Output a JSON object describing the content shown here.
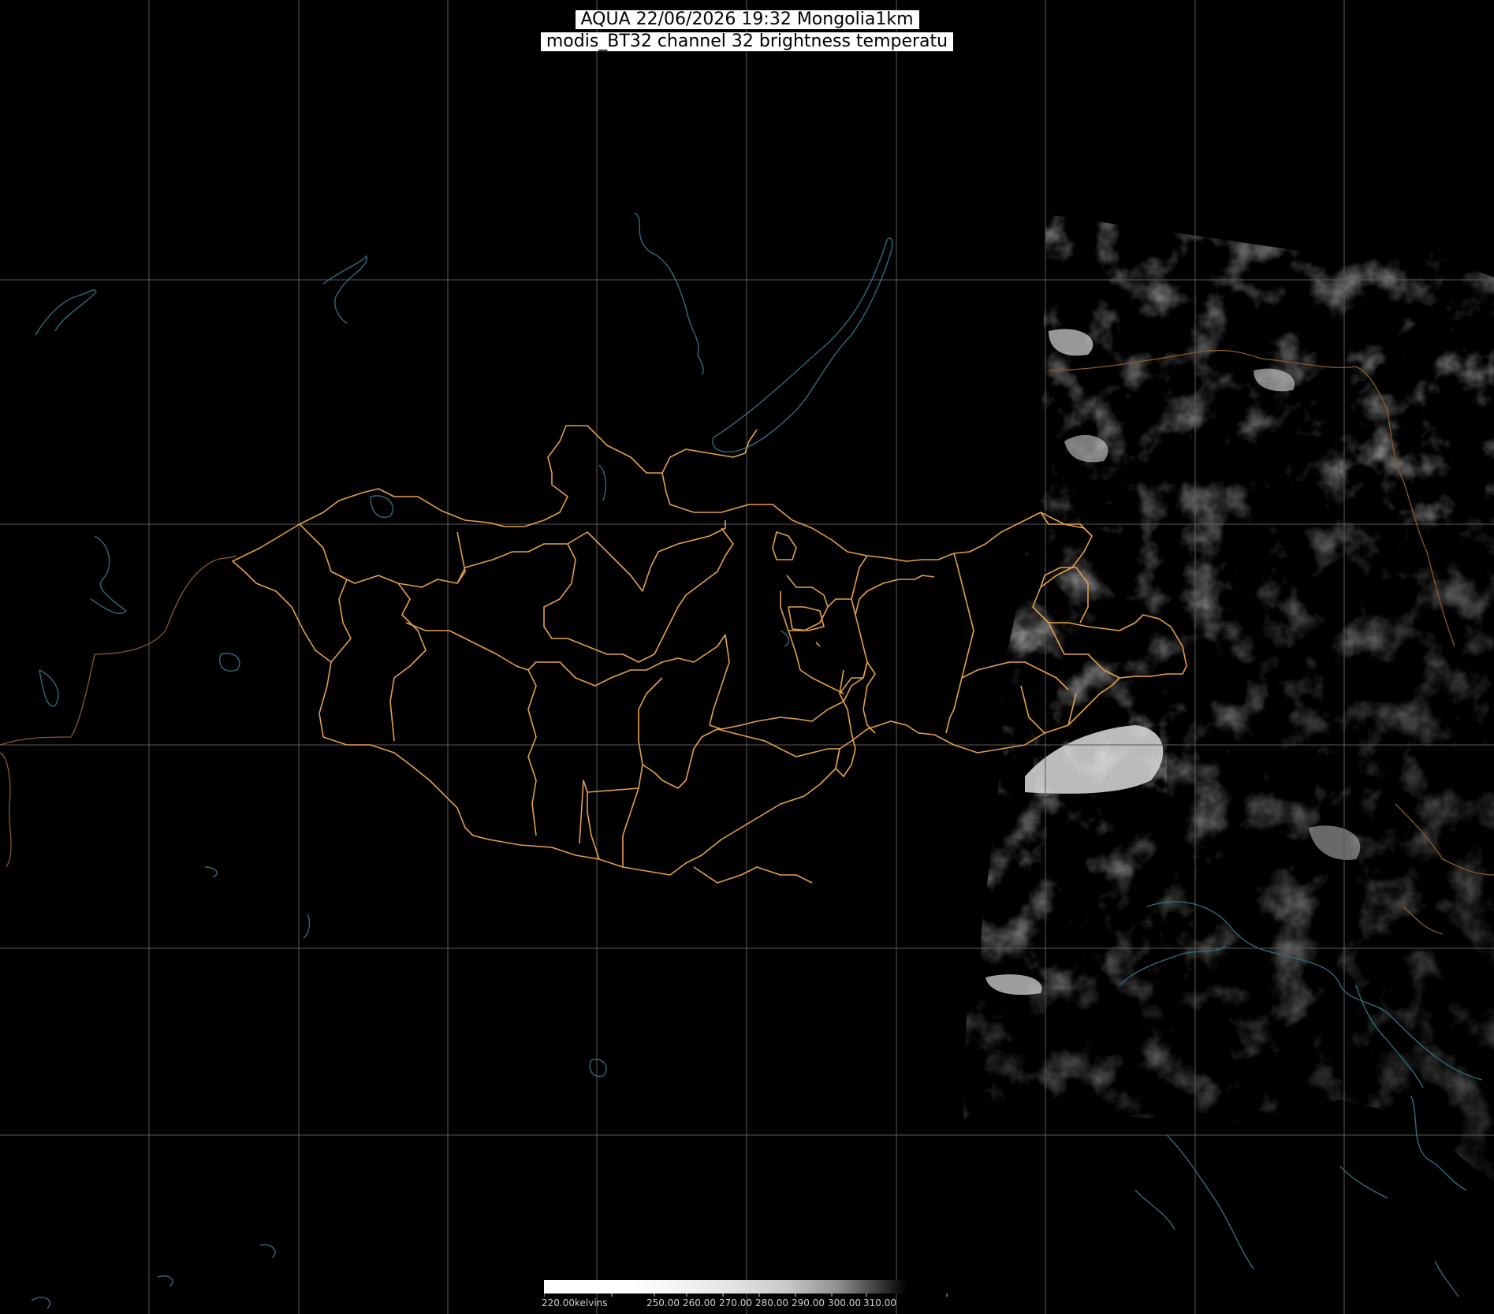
{
  "title": {
    "line1": "AQUA 22/06/2026 19:32 Mongolia1km",
    "line2": "modis_BT32 channel 32 brightness temperatu"
  },
  "legend": {
    "labels": [
      "220.00kelvins",
      "250.00",
      "260.00",
      "270.00",
      "280.00",
      "290.00",
      "300.00",
      "310.00"
    ],
    "colors": {
      "low": "#ffffff",
      "high": "#000000"
    }
  },
  "map": {
    "background": "#000000",
    "graticule_color": "#5a5a5a",
    "border_color": "#e3a04c",
    "coast_color": "#2e6d7a",
    "swath": "grayscale brightness temperature"
  }
}
